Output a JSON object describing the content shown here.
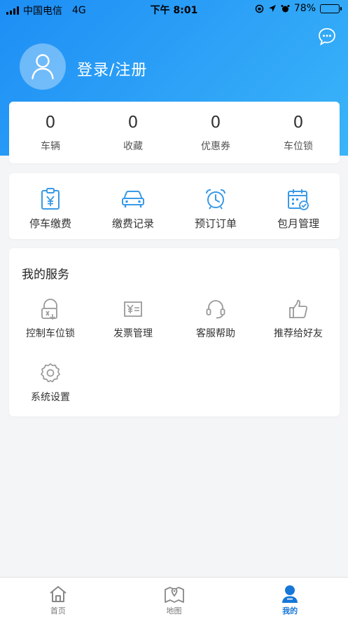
{
  "status_bar": {
    "carrier": "中国电信",
    "network": "4G",
    "time": "下午 8:01",
    "battery_percent": "78%",
    "battery_level": 0.78
  },
  "header": {
    "login_label": "登录/注册",
    "message_icon": "chat-bubble-icon",
    "avatar_icon": "user-icon"
  },
  "stats": [
    {
      "value": "0",
      "label": "车辆"
    },
    {
      "value": "0",
      "label": "收藏"
    },
    {
      "value": "0",
      "label": "优惠券"
    },
    {
      "value": "0",
      "label": "车位锁"
    }
  ],
  "quick_actions": [
    {
      "label": "停车缴费",
      "icon": "parking-payment-icon"
    },
    {
      "label": "缴费记录",
      "icon": "car-icon"
    },
    {
      "label": "预订订单",
      "icon": "alarm-clock-icon"
    },
    {
      "label": "包月管理",
      "icon": "calendar-check-icon"
    }
  ],
  "services": {
    "title": "我的服务",
    "items": [
      {
        "label": "控制车位锁",
        "icon": "parking-lock-icon"
      },
      {
        "label": "发票管理",
        "icon": "invoice-icon"
      },
      {
        "label": "客服帮助",
        "icon": "headset-icon"
      },
      {
        "label": "推荐给好友",
        "icon": "thumbs-up-icon"
      },
      {
        "label": "系统设置",
        "icon": "gear-icon"
      }
    ]
  },
  "tabbar": [
    {
      "label": "首页",
      "icon": "home-icon"
    },
    {
      "label": "地图",
      "icon": "map-icon"
    },
    {
      "label": "我的",
      "icon": "profile-icon",
      "active": true
    }
  ],
  "colors": {
    "accent": "#1d8ef5",
    "icon_blue": "#3a9ae6",
    "active_tab": "#1677d8"
  }
}
